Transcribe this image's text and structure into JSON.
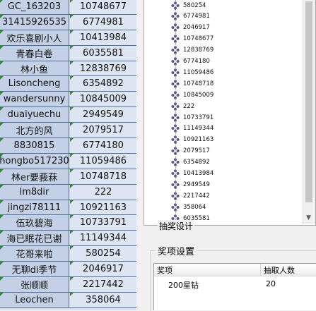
{
  "sheet": {
    "rows": [
      {
        "name": "GC_163203",
        "value": "10748677"
      },
      {
        "name": "31415926535",
        "value": "6774981"
      },
      {
        "name": "欢乐喜剧小人",
        "value": "10413984"
      },
      {
        "name": "青春白卷",
        "value": "6035581"
      },
      {
        "name": "林小鱼",
        "value": "12838769"
      },
      {
        "name": "Lisoncheng",
        "value": "6354892"
      },
      {
        "name": "wandersunny",
        "value": "10845009"
      },
      {
        "name": "duaiyuechu",
        "value": "2949549"
      },
      {
        "name": "北方的风",
        "value": "2079517"
      },
      {
        "name": "8830815",
        "value": "6774180"
      },
      {
        "name": "hongbo517230",
        "value": "11059486"
      },
      {
        "name": "林er要莪菻",
        "value": "10748718"
      },
      {
        "name": "lm8dir",
        "value": "222"
      },
      {
        "name": "jingzi78111",
        "value": "10921163"
      },
      {
        "name": "伍玖碧海",
        "value": "10733791"
      },
      {
        "name": "海已眠花已谢",
        "value": "11149344"
      },
      {
        "name": "花哥来啦",
        "value": "580254"
      },
      {
        "name": "无聊di季节",
        "value": "2046917"
      },
      {
        "name": "张顺顺",
        "value": "2217442"
      },
      {
        "name": "Leochen",
        "value": "358064"
      }
    ]
  },
  "tree": {
    "items": [
      "580254",
      "6774981",
      "2046917",
      "10748677",
      "12838769",
      "6774180",
      "11059486",
      "10748718",
      "10845009",
      "222",
      "10733791",
      "11149344",
      "10921163",
      "2079517",
      "6354892",
      "10413984",
      "2949549",
      "2217442",
      "358064",
      "6035581"
    ]
  },
  "lottery_partial_label": "抽奖设计",
  "prize": {
    "title": "奖项设置",
    "columns": [
      "奖项",
      "抽取人数"
    ],
    "rows": [
      {
        "item": "200星钻",
        "count": "20"
      }
    ]
  },
  "colors": {
    "trianglemarker": "#2e8b2e",
    "selectedcell": "#c3d0e5"
  }
}
